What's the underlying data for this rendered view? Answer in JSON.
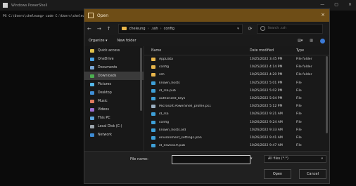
{
  "app": {
    "title": "Windows PowerShell",
    "terminal_text": "PS C:\\Users\\cheleung> code C:\\Users\\cheleung\\.ssh\\config ."
  },
  "dialog": {
    "title": "Open",
    "nav_back": "←",
    "nav_forward": "→",
    "nav_up": "↑",
    "breadcrumb": [
      "cheleung",
      ".ssh",
      "config"
    ],
    "search_placeholder": "Search .ssh",
    "command_bar": {
      "organize": "Organize ▾",
      "new_folder": "New folder"
    },
    "nav_items": [
      {
        "label": "Quick access",
        "icon": "star-icon"
      },
      {
        "label": "OneDrive",
        "icon": "cloud-icon"
      },
      {
        "label": "Documents",
        "icon": "document-icon"
      },
      {
        "label": "Downloads",
        "icon": "download-icon",
        "selected": true
      },
      {
        "label": "Pictures",
        "icon": "image-icon"
      },
      {
        "label": "Desktop",
        "icon": "desktop-icon"
      },
      {
        "label": "Music",
        "icon": "music-icon"
      },
      {
        "label": "Videos",
        "icon": "video-icon"
      },
      {
        "label": "This PC",
        "icon": "computer-icon"
      },
      {
        "label": "Local Disk (C:)",
        "icon": "drive-icon"
      },
      {
        "label": "Network",
        "icon": "network-icon"
      }
    ],
    "columns": {
      "name": "Name",
      "date": "Date modified",
      "type": "Type"
    },
    "files": [
      {
        "name": "AppData",
        "date": "10/25/2022 3:45 PM",
        "type": "File folder",
        "icon": "folder"
      },
      {
        "name": "config",
        "date": "10/25/2022 4:14 PM",
        "type": "File folder",
        "icon": "folder"
      },
      {
        "name": "ssh",
        "date": "10/25/2022 4:20 PM",
        "type": "File folder",
        "icon": "folder"
      },
      {
        "name": "known_hosts",
        "date": "10/25/2022 5:01 PM",
        "type": "File",
        "icon": "doc"
      },
      {
        "name": "id_rsa.pub",
        "date": "10/25/2022 5:02 PM",
        "type": "File",
        "icon": "doc"
      },
      {
        "name": "authorized_keys",
        "date": "10/25/2022 5:04 PM",
        "type": "File",
        "icon": "doc"
      },
      {
        "name": "Microsoft.PowerShell_profile.ps1",
        "date": "10/25/2022 5:12 PM",
        "type": "File",
        "icon": "txt"
      },
      {
        "name": "id_rsa",
        "date": "10/26/2022 9:21 AM",
        "type": "File",
        "icon": "doc"
      },
      {
        "name": "config",
        "date": "10/26/2022 9:24 AM",
        "type": "File",
        "icon": "doc"
      },
      {
        "name": "known_hosts.old",
        "date": "10/26/2022 9:33 AM",
        "type": "File",
        "icon": "doc"
      },
      {
        "name": "environment_settings.json",
        "date": "10/26/2022 9:41 AM",
        "type": "File",
        "icon": "doc"
      },
      {
        "name": "id_ed25519.pub",
        "date": "10/26/2022 9:47 AM",
        "type": "File",
        "icon": "doc"
      }
    ],
    "footer": {
      "filename_label": "File name:",
      "filename_value": "",
      "filetype_value": "All files (*.*)",
      "open_label": "Open",
      "cancel_label": "Cancel"
    }
  }
}
